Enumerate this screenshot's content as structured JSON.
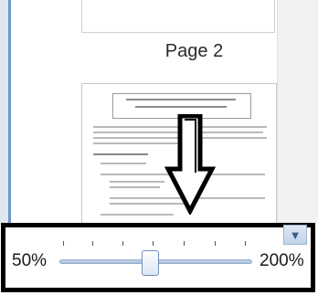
{
  "viewer": {
    "page_label": "Page 2",
    "zoom": {
      "min_label": "50%",
      "max_label": "200%",
      "level_fraction": 0.47
    }
  },
  "icons": {
    "scroll_down": "chevron-down-icon",
    "annotation": "down-arrow-icon"
  }
}
